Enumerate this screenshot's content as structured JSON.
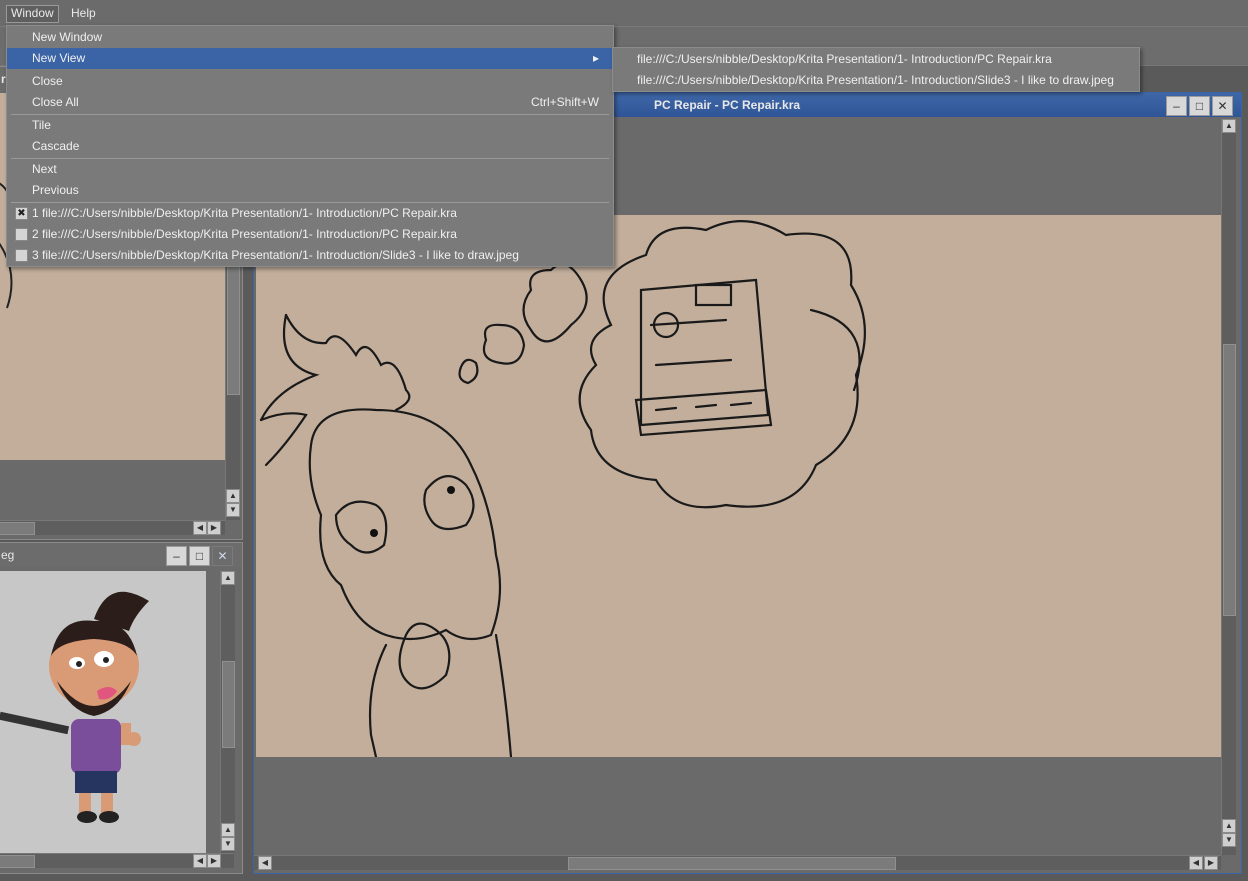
{
  "menubar": {
    "window": "Window",
    "help": "Help"
  },
  "window_menu": {
    "items": [
      {
        "label": "New Window"
      },
      {
        "label": "New View",
        "submenu_arrow": "▸"
      },
      {
        "label": "Close"
      },
      {
        "label": "Close All",
        "shortcut": "Ctrl+Shift+W"
      },
      {
        "label": "Tile"
      },
      {
        "label": "Cascade"
      },
      {
        "label": "Next"
      },
      {
        "label": "Previous"
      },
      {
        "label": "1 file:///C:/Users/nibble/Desktop/Krita Presentation/1- Introduction/PC Repair.kra",
        "checked": true
      },
      {
        "label": "2 file:///C:/Users/nibble/Desktop/Krita Presentation/1- Introduction/PC Repair.kra",
        "checked": false
      },
      {
        "label": "3 file:///C:/Users/nibble/Desktop/Krita Presentation/1- Introduction/Slide3 - I like to draw.jpeg",
        "checked": false
      }
    ]
  },
  "new_view_submenu": [
    "file:///C:/Users/nibble/Desktop/Krita Presentation/1- Introduction/PC Repair.kra",
    "file:///C:/Users/nibble/Desktop/Krita Presentation/1- Introduction/Slide3 - I like to draw.jpeg"
  ],
  "main_window": {
    "title": "PC Repair - PC Repair.kra"
  },
  "bottom_left_window": {
    "title_fragment": "eg"
  },
  "top_left_window": {
    "title_fragment": "ra"
  },
  "colors": {
    "canvas": "#c2ae9b",
    "active_title": "#3a64a5",
    "menu_bg": "#7a7a7a",
    "app_bg": "#5b5b5b"
  },
  "icons": {
    "minimize": "minimize-icon",
    "maximize": "maximize-icon",
    "close": "close-icon",
    "check": "checkmark-icon"
  }
}
